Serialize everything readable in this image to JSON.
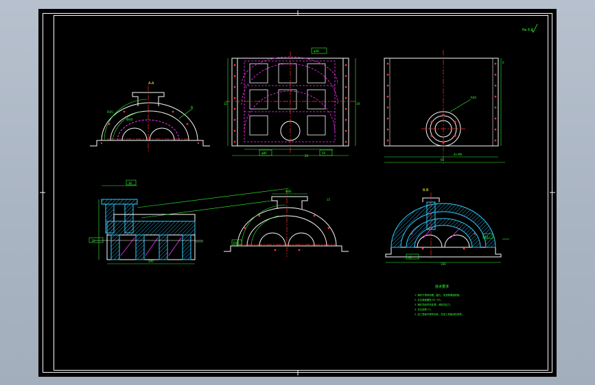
{
  "app": {
    "background_color": "#aab5c3",
    "sheet_color": "#000000"
  },
  "colors": {
    "frame": "#ffffff",
    "outline": "#ffffff",
    "centerline": "#ff3030",
    "hidden": "#ff33ff",
    "dimension": "#33ff33",
    "hatch": "#33ccff",
    "label": "#ffff33",
    "magenta": "#ff00ff"
  },
  "drawing": {
    "roughness_mark": "Ra 6.3",
    "view_labels": {
      "top_left": "A-A",
      "bottom_right": "B-B"
    },
    "dims": {
      "d1": "R45",
      "d2": "8",
      "d3": "Ф40",
      "d4": "φ38",
      "d5": "φ80",
      "d6": "50",
      "d7": "12",
      "d8": "18",
      "d9": "26",
      "d10": "R40",
      "d11": "4x M6",
      "d12": "65",
      "d13": "6",
      "d14": "12",
      "d15": "36",
      "d16": "R48",
      "d17": "15",
      "d18": "Ф66",
      "d19": "45",
      "d20": "200",
      "d21": "44",
      "d22": "30",
      "d23": "φ20",
      "d24": "120",
      "d25": "160",
      "d26": "10",
      "d27": "120",
      "d28": "54"
    },
    "notes": {
      "title": "技术要求",
      "lines": [
        "1. 铸件不得有砂眼、缩孔、夹渣等铸造缺陷。",
        "2. 未注铸造圆角 R3~R5。",
        "3. 铸件须经时效处理，消除内应力。",
        "4. 未注倒角 C1。",
        "5. 加工表面不得有毛刺，非加工表面涂防锈漆。"
      ]
    }
  }
}
